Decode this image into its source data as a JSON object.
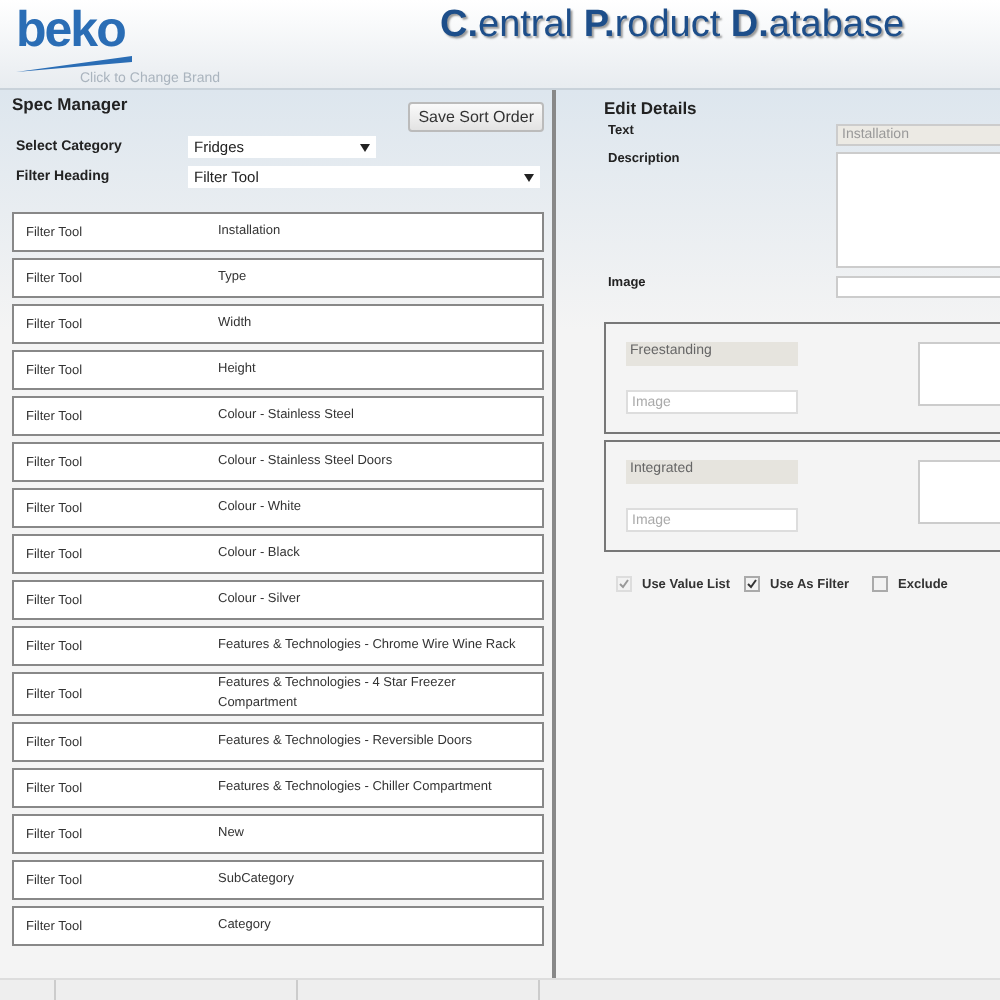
{
  "header": {
    "brand": "beko",
    "brand_link": "Click to Change Brand",
    "title": [
      {
        "initial": "C.",
        "rest": "entral "
      },
      {
        "initial": "P.",
        "rest": "roduct "
      },
      {
        "initial": "D.",
        "rest": "atabase"
      }
    ]
  },
  "spec_manager": {
    "title": "Spec Manager",
    "save_button": "Save Sort Order",
    "fields": [
      {
        "label": "Select Category",
        "value": "Fridges",
        "kind": "short"
      },
      {
        "label": "Filter Heading",
        "value": "Filter Tool",
        "kind": "wide"
      }
    ],
    "rows": [
      {
        "heading": "Filter Tool",
        "name": "Installation"
      },
      {
        "heading": "Filter Tool",
        "name": "Type"
      },
      {
        "heading": "Filter Tool",
        "name": "Width"
      },
      {
        "heading": "Filter Tool",
        "name": "Height"
      },
      {
        "heading": "Filter Tool",
        "name": "Colour - Stainless Steel"
      },
      {
        "heading": "Filter Tool",
        "name": "Colour - Stainless Steel Doors"
      },
      {
        "heading": "Filter Tool",
        "name": "Colour - White"
      },
      {
        "heading": "Filter Tool",
        "name": "Colour - Black"
      },
      {
        "heading": "Filter Tool",
        "name": "Colour - Silver"
      },
      {
        "heading": "Filter Tool",
        "name": "Features & Technologies - Chrome Wire Wine Rack"
      },
      {
        "heading": "Filter Tool",
        "name": "Features & Technologies - 4 Star Freezer Compartment"
      },
      {
        "heading": "Filter Tool",
        "name": "Features & Technologies - Reversible Doors"
      },
      {
        "heading": "Filter Tool",
        "name": "Features & Technologies - Chiller Compartment"
      },
      {
        "heading": "Filter Tool",
        "name": "New"
      },
      {
        "heading": "Filter Tool",
        "name": "SubCategory"
      },
      {
        "heading": "Filter Tool",
        "name": "Category"
      }
    ]
  },
  "edit_details": {
    "title": "Edit Details",
    "text_label": "Text",
    "text_value": "Installation",
    "description_label": "Description",
    "image_label": "Image",
    "values": [
      {
        "value": "Freestanding",
        "image_placeholder": "Image"
      },
      {
        "value": "Integrated",
        "image_placeholder": "Image"
      }
    ],
    "checkboxes": [
      {
        "label": "Use Value List",
        "checked": true,
        "disabled": true
      },
      {
        "label": "Use As Filter",
        "checked": true,
        "disabled": false
      },
      {
        "label": "Exclude",
        "checked": false,
        "disabled": false
      }
    ]
  }
}
